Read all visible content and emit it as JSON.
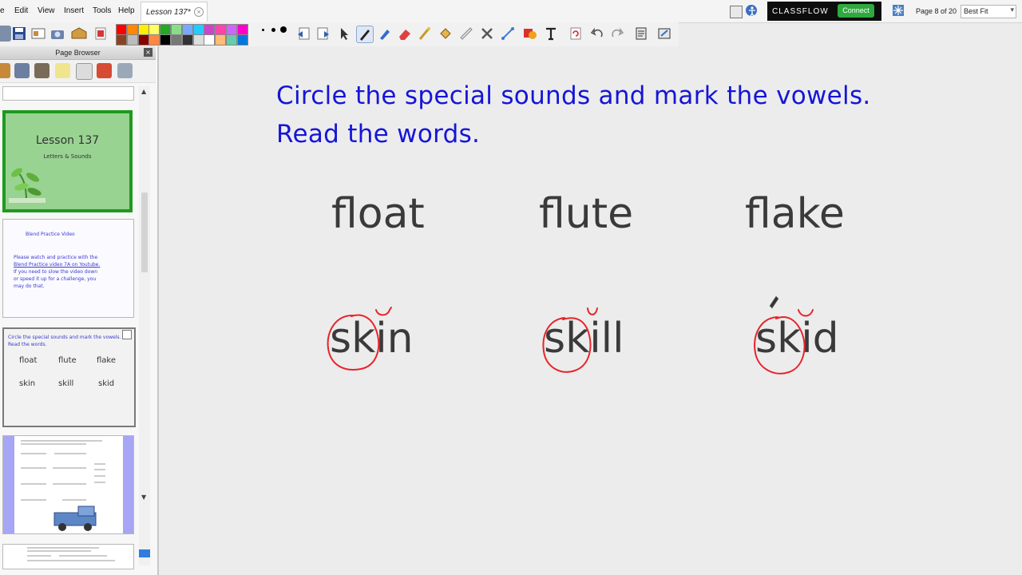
{
  "menu": [
    "e",
    "Edit",
    "View",
    "Insert",
    "Tools",
    "Help"
  ],
  "document_tab": {
    "title": "Lesson 137*"
  },
  "classflow": {
    "brand": "CLASSFLOW",
    "connect_label": "Connect"
  },
  "page_indicator": "Page 8 of 20",
  "zoom": {
    "value": "Best Fit"
  },
  "toolbar": {
    "palette": [
      "#ff0000",
      "#ff8800",
      "#ffee00",
      "#ffff66",
      "#22aa22",
      "#88dd88",
      "#77aaff",
      "#22ccff",
      "#cc44cc",
      "#ff44aa",
      "#cc66ff",
      "#ff00cc",
      "#884422",
      "#bbbbbb",
      "#880000",
      "#ff8844",
      "#000000",
      "#777777",
      "#333333",
      "#dddddd",
      "#ffffff",
      "#ffbb77",
      "#66ccaa",
      "#0077dd"
    ]
  },
  "page_browser": {
    "title": "Page Browser",
    "thumbnails": {
      "cover": {
        "title": "Lesson 137",
        "subtitle": "Letters & Sounds"
      },
      "video": {
        "heading": "Blend Practice Video",
        "body": [
          "Please watch and practice with the",
          "Blend Practice video 7A on Youtube.",
          "If you need to slow the video down",
          "or speed it up for a challenge, you",
          "may do that."
        ]
      },
      "current": {
        "instruction": [
          "Circle the special sounds and mark the vowels.",
          "Read the words."
        ],
        "words_row1": [
          "float",
          "flute",
          "flake"
        ],
        "words_row2": [
          "skin",
          "skill",
          "skid"
        ]
      }
    }
  },
  "page": {
    "instruction_line1": "Circle the special sounds and mark the vowels.",
    "instruction_line2": "Read the words.",
    "row1": [
      "float",
      "flute",
      "flake"
    ],
    "row2": [
      "skin",
      "skill",
      "skid"
    ]
  },
  "ink": {
    "color": "#e8232a"
  }
}
